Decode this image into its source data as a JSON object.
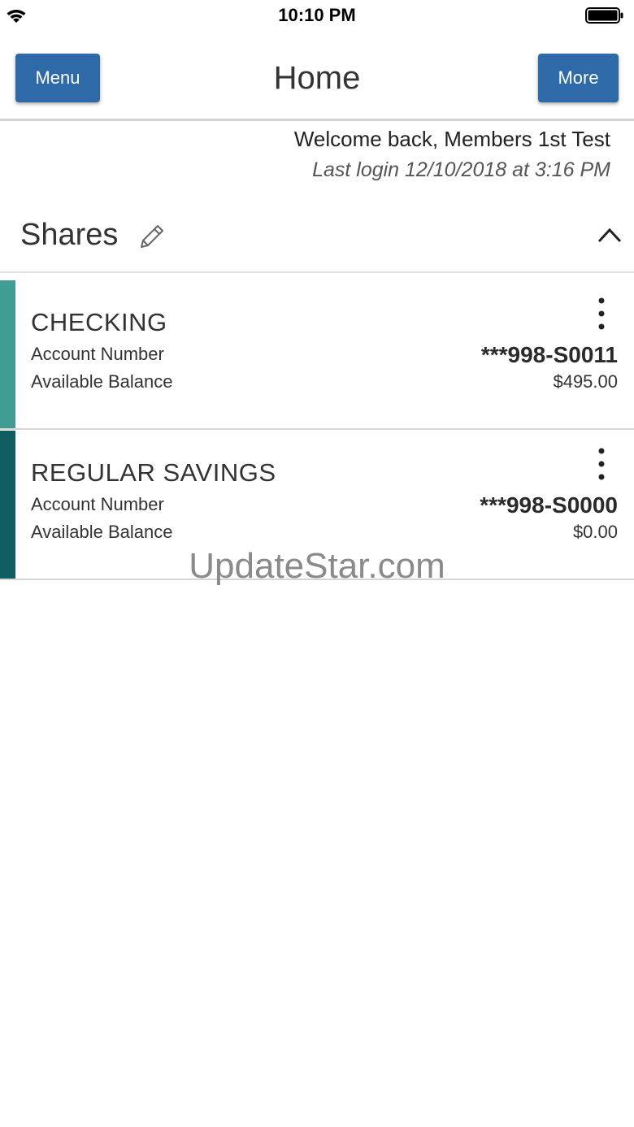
{
  "status_bar": {
    "time": "10:10 PM"
  },
  "header": {
    "title": "Home",
    "menu_label": "Menu",
    "more_label": "More"
  },
  "welcome": {
    "message": "Welcome back, Members 1st Test",
    "last_login": "Last login 12/10/2018 at 3:16 PM"
  },
  "shares": {
    "title": "Shares",
    "accounts": [
      {
        "name": "CHECKING",
        "number_label": "Account Number",
        "number": "***998-S0011",
        "balance_label": "Available Balance",
        "balance": "$495.00",
        "accent_color": "#3f9d93"
      },
      {
        "name": "REGULAR SAVINGS",
        "number_label": "Account Number",
        "number": "***998-S0000",
        "balance_label": "Available Balance",
        "balance": "$0.00",
        "accent_color": "#0f5c61"
      }
    ]
  },
  "watermark": "UpdateStar.com",
  "colors": {
    "primary_button": "#2e6aa8"
  }
}
